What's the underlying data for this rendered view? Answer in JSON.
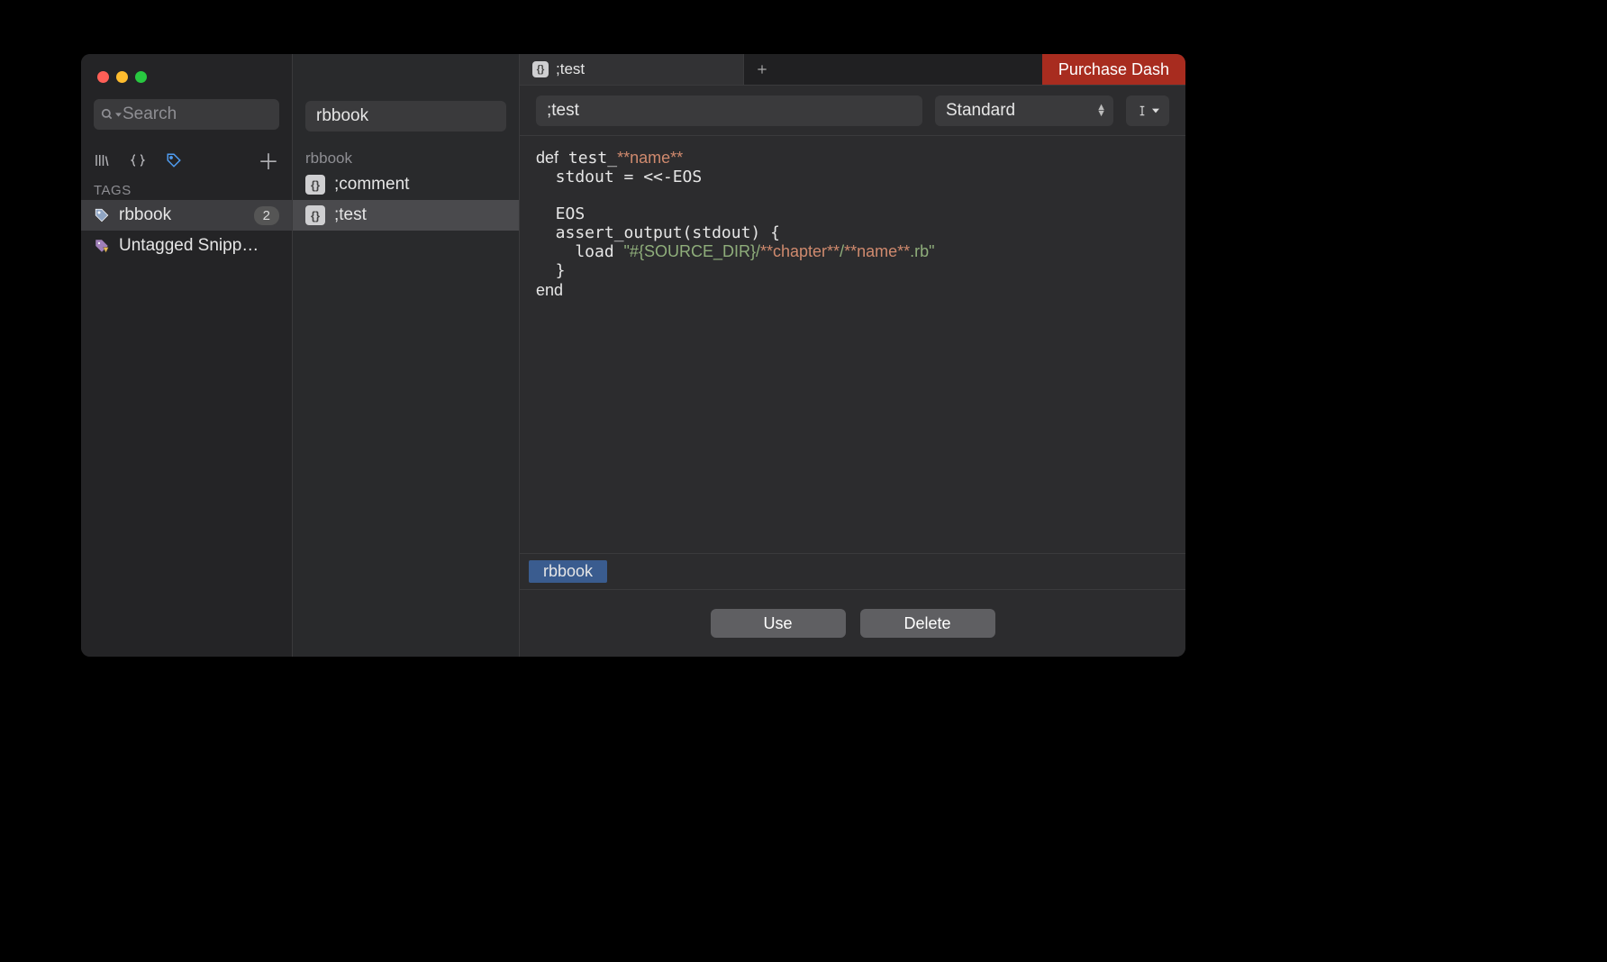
{
  "sidebar": {
    "search_placeholder": "Search",
    "tags_heading": "TAGS",
    "tags": [
      {
        "name": "rbbook",
        "count": "2",
        "icon": "tag-icon"
      },
      {
        "name": "Untagged Snipp…",
        "count": null,
        "icon": "tag-warning-icon"
      }
    ]
  },
  "sidebar2": {
    "filter_value": "rbbook",
    "group_label": "rbbook",
    "snippets": [
      {
        "label": ";comment"
      },
      {
        "label": ";test"
      }
    ]
  },
  "tabs": {
    "active_label": ";test"
  },
  "purchase_label": "Purchase Dash",
  "editor": {
    "title": ";test",
    "select_label": "Standard",
    "code_plain": "def test_**name**\n  stdout = <<-EOS\n\n  EOS\n  assert_output(stdout) {\n    load \"#{SOURCE_DIR}/**chapter**/**name**.rb\"\n  }\nend",
    "tag": "rbbook"
  },
  "buttons": {
    "use": "Use",
    "delete": "Delete"
  }
}
